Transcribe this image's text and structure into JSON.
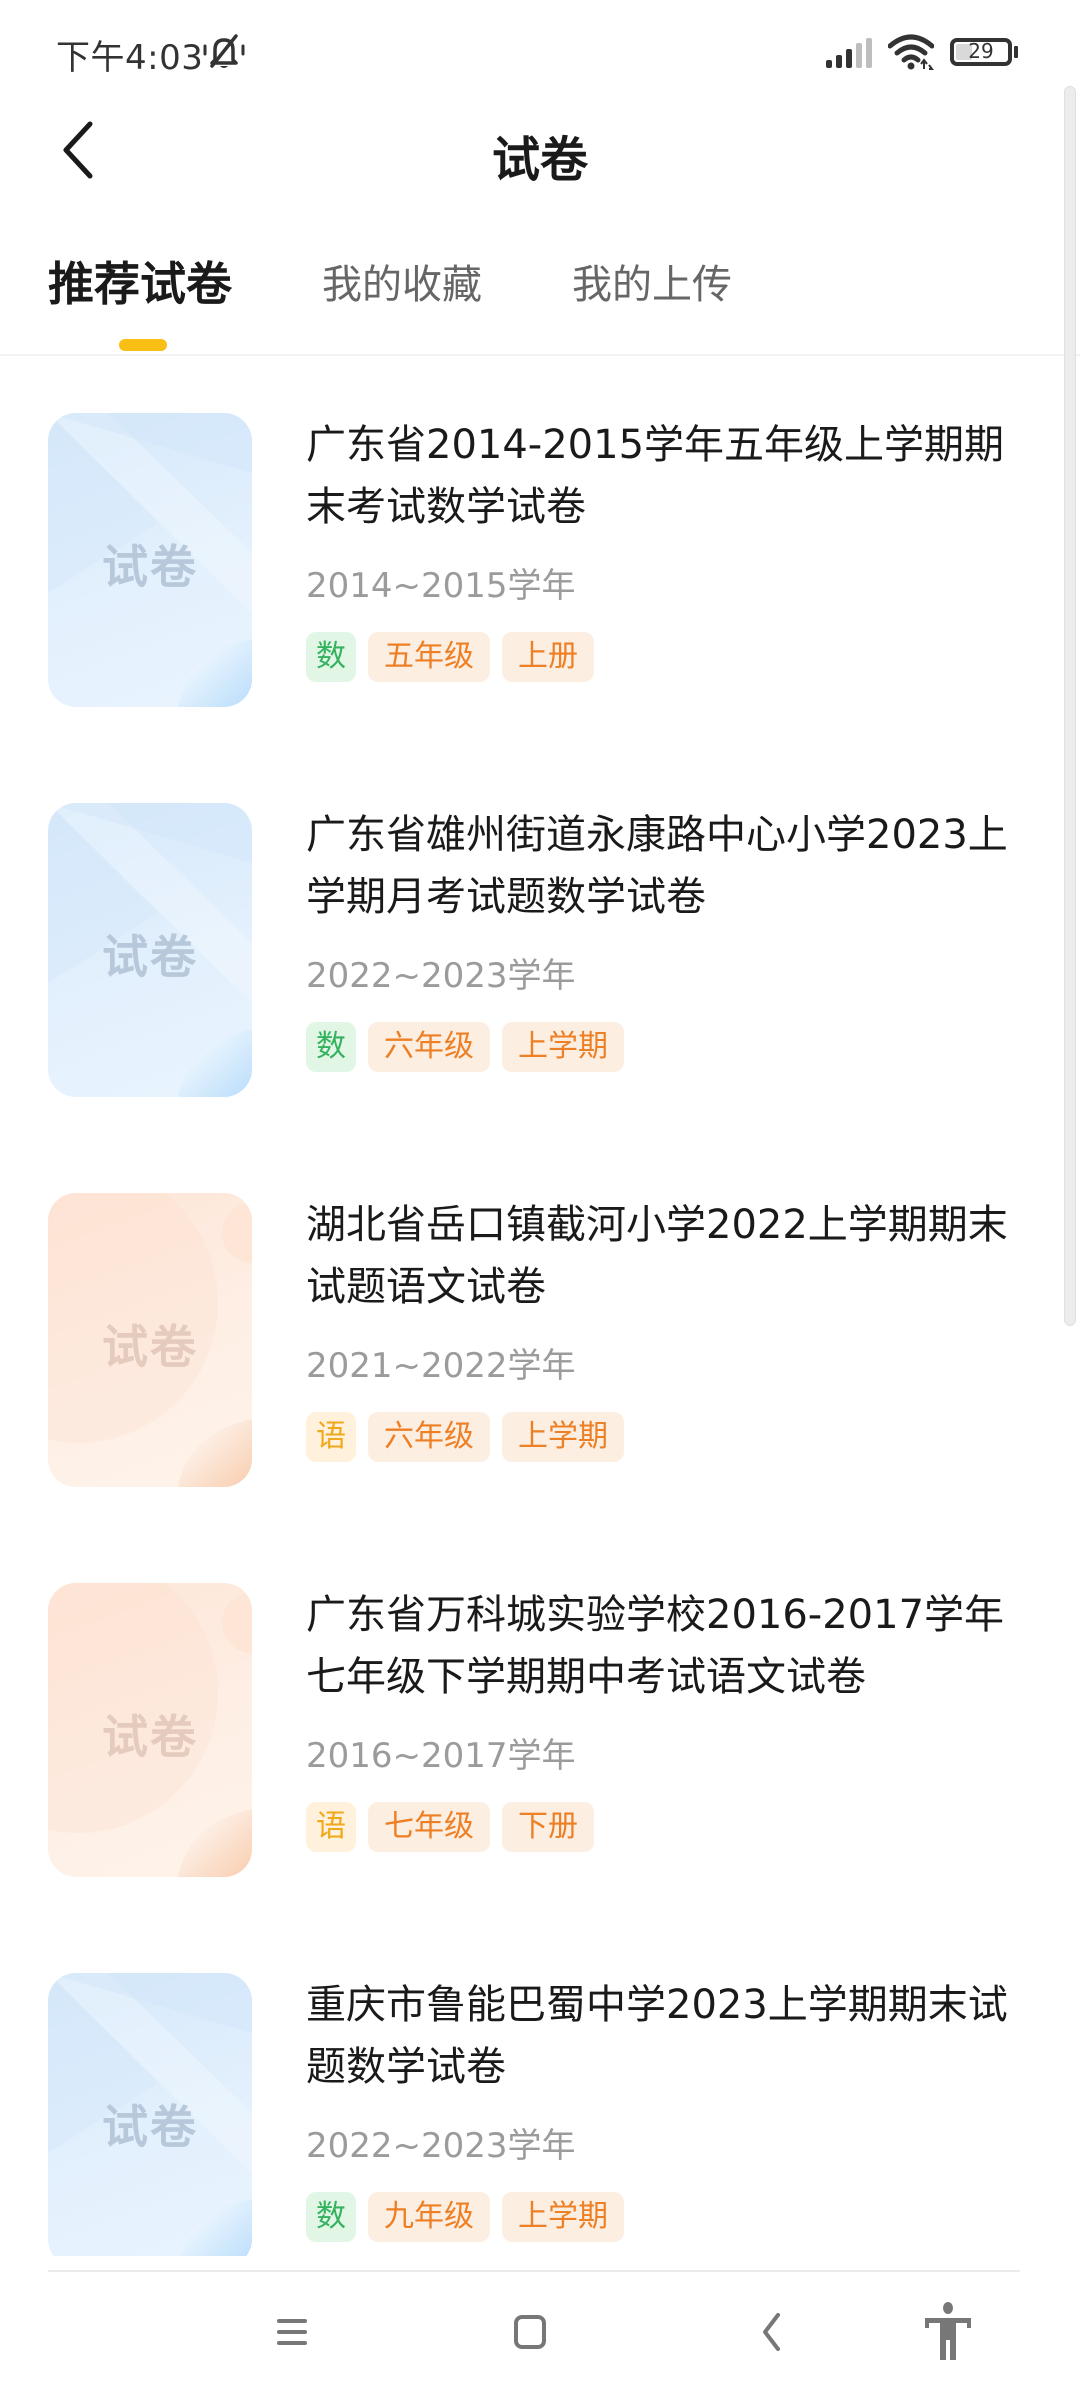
{
  "status_bar": {
    "time": "下午4:03",
    "icons": [
      "mute-icon",
      "signal-icon",
      "wifi-icon",
      "battery-icon"
    ],
    "battery_level": "29"
  },
  "header": {
    "back_icon": "chevron-left-icon",
    "title": "试卷"
  },
  "tabs": [
    {
      "label": "推荐试卷",
      "active": true
    },
    {
      "label": "我的收藏",
      "active": false
    },
    {
      "label": "我的上传",
      "active": false
    }
  ],
  "colors": {
    "accent": "#f9bf15",
    "math_tag_text": "#35b25e",
    "math_tag_bg": "#e2f6e6",
    "chinese_tag_text": "#f0a81c",
    "chinese_tag_bg": "#fff1dc",
    "grade_tag_text": "#ed7f24",
    "grade_tag_bg": "#fdeee2"
  },
  "papers": [
    {
      "thumb_label": "试卷",
      "thumb_theme": "blue",
      "title": "广东省2014-2015学年五年级上学期期末考试数学试卷",
      "year": "2014~2015学年",
      "subject": "数",
      "subject_type": "math",
      "grade": "五年级",
      "term": "上册"
    },
    {
      "thumb_label": "试卷",
      "thumb_theme": "blue",
      "title": "广东省雄州街道永康路中心小学2023上学期月考试题数学试卷",
      "year": "2022~2023学年",
      "subject": "数",
      "subject_type": "math",
      "grade": "六年级",
      "term": "上学期"
    },
    {
      "thumb_label": "试卷",
      "thumb_theme": "orange",
      "title": "湖北省岳口镇截河小学2022上学期期末试题语文试卷",
      "year": "2021~2022学年",
      "subject": "语",
      "subject_type": "chinese",
      "grade": "六年级",
      "term": "上学期"
    },
    {
      "thumb_label": "试卷",
      "thumb_theme": "orange",
      "title": "广东省万科城实验学校2016-2017学年七年级下学期期中考试语文试卷",
      "year": "2016~2017学年",
      "subject": "语",
      "subject_type": "chinese",
      "grade": "七年级",
      "term": "下册"
    },
    {
      "thumb_label": "试卷",
      "thumb_theme": "blue",
      "title": "重庆市鲁能巴蜀中学2023上学期期末试题数学试卷",
      "year": "2022~2023学年",
      "subject": "数",
      "subject_type": "math",
      "grade": "九年级",
      "term": "上学期"
    }
  ],
  "nav_bar": {
    "buttons": [
      "menu-icon",
      "home-icon",
      "back-icon",
      "accessibility-icon"
    ]
  }
}
